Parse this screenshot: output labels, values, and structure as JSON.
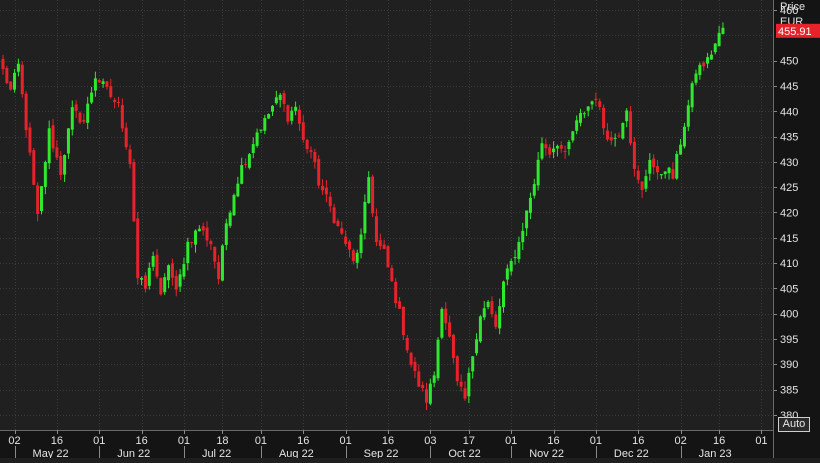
{
  "chart_data": {
    "type": "candlestick",
    "title": "",
    "price_label": "Price",
    "currency_label": "EUR",
    "last_price": "455.91",
    "ylim": [
      377,
      462
    ],
    "y_ticks": [
      380,
      385,
      390,
      395,
      400,
      405,
      410,
      415,
      420,
      425,
      430,
      435,
      440,
      445,
      450,
      455,
      460
    ],
    "grid": true,
    "up_color": "#2ee82e",
    "down_color": "#e8222a",
    "day_ticks": [
      {
        "idx": 3,
        "label": "02"
      },
      {
        "idx": 14,
        "label": "16"
      },
      {
        "idx": 25,
        "label": "01"
      },
      {
        "idx": 36,
        "label": "16"
      },
      {
        "idx": 47,
        "label": "01"
      },
      {
        "idx": 57,
        "label": "18"
      },
      {
        "idx": 67,
        "label": "01"
      },
      {
        "idx": 78,
        "label": "16"
      },
      {
        "idx": 89,
        "label": "01"
      },
      {
        "idx": 100,
        "label": "16"
      },
      {
        "idx": 111,
        "label": "03"
      },
      {
        "idx": 121,
        "label": "17"
      },
      {
        "idx": 132,
        "label": "01"
      },
      {
        "idx": 143,
        "label": "16"
      },
      {
        "idx": 154,
        "label": "01"
      },
      {
        "idx": 165,
        "label": "16"
      },
      {
        "idx": 176,
        "label": "02"
      },
      {
        "idx": 186,
        "label": "16"
      },
      {
        "idx": 197,
        "label": "01"
      }
    ],
    "month_ticks": [
      {
        "idx": 3,
        "label": "May 22"
      },
      {
        "idx": 25,
        "label": "Jun 22"
      },
      {
        "idx": 47,
        "label": "Jul 22"
      },
      {
        "idx": 67,
        "label": "Aug 22"
      },
      {
        "idx": 89,
        "label": "Sep 22"
      },
      {
        "idx": 111,
        "label": "Oct 22"
      },
      {
        "idx": 132,
        "label": "Nov 22"
      },
      {
        "idx": 154,
        "label": "Dec 22"
      },
      {
        "idx": 176,
        "label": "Jan 23"
      }
    ],
    "anchors": [
      [
        0,
        448
      ],
      [
        2,
        444
      ],
      [
        4,
        449
      ],
      [
        6,
        437
      ],
      [
        9,
        419
      ],
      [
        12,
        436
      ],
      [
        15,
        428
      ],
      [
        18,
        440
      ],
      [
        21,
        438
      ],
      [
        24,
        447
      ],
      [
        27,
        444
      ],
      [
        30,
        441
      ],
      [
        33,
        430
      ],
      [
        35,
        407
      ],
      [
        37,
        405
      ],
      [
        39,
        412
      ],
      [
        41,
        403
      ],
      [
        43,
        410
      ],
      [
        45,
        404
      ],
      [
        48,
        414
      ],
      [
        51,
        417
      ],
      [
        54,
        414
      ],
      [
        56,
        407
      ],
      [
        58,
        418
      ],
      [
        60,
        424
      ],
      [
        62,
        429
      ],
      [
        64,
        432
      ],
      [
        66,
        436
      ],
      [
        68,
        438
      ],
      [
        70,
        441
      ],
      [
        72,
        443
      ],
      [
        74,
        439
      ],
      [
        76,
        441
      ],
      [
        78,
        434
      ],
      [
        80,
        432
      ],
      [
        82,
        426
      ],
      [
        85,
        421
      ],
      [
        87,
        417
      ],
      [
        89,
        414
      ],
      [
        91,
        410
      ],
      [
        93,
        415
      ],
      [
        95,
        427
      ],
      [
        97,
        414
      ],
      [
        99,
        412
      ],
      [
        101,
        406
      ],
      [
        103,
        400
      ],
      [
        106,
        390
      ],
      [
        108,
        386
      ],
      [
        110,
        383
      ],
      [
        112,
        388
      ],
      [
        114,
        402
      ],
      [
        116,
        395
      ],
      [
        118,
        386
      ],
      [
        120,
        383
      ],
      [
        122,
        392
      ],
      [
        124,
        400
      ],
      [
        126,
        402
      ],
      [
        128,
        397
      ],
      [
        130,
        406
      ],
      [
        132,
        410
      ],
      [
        134,
        414
      ],
      [
        136,
        420
      ],
      [
        138,
        426
      ],
      [
        140,
        434
      ],
      [
        142,
        432
      ],
      [
        144,
        434
      ],
      [
        146,
        431
      ],
      [
        148,
        436
      ],
      [
        150,
        439
      ],
      [
        152,
        441
      ],
      [
        154,
        443
      ],
      [
        156,
        437
      ],
      [
        158,
        434
      ],
      [
        160,
        436
      ],
      [
        162,
        441
      ],
      [
        164,
        428
      ],
      [
        166,
        424
      ],
      [
        168,
        431
      ],
      [
        170,
        427
      ],
      [
        172,
        429
      ],
      [
        174,
        427
      ],
      [
        176,
        434
      ],
      [
        178,
        441
      ],
      [
        180,
        448
      ],
      [
        183,
        450
      ],
      [
        186,
        455
      ],
      [
        187,
        456.5
      ]
    ]
  },
  "controls": {
    "auto_label": "Auto"
  }
}
